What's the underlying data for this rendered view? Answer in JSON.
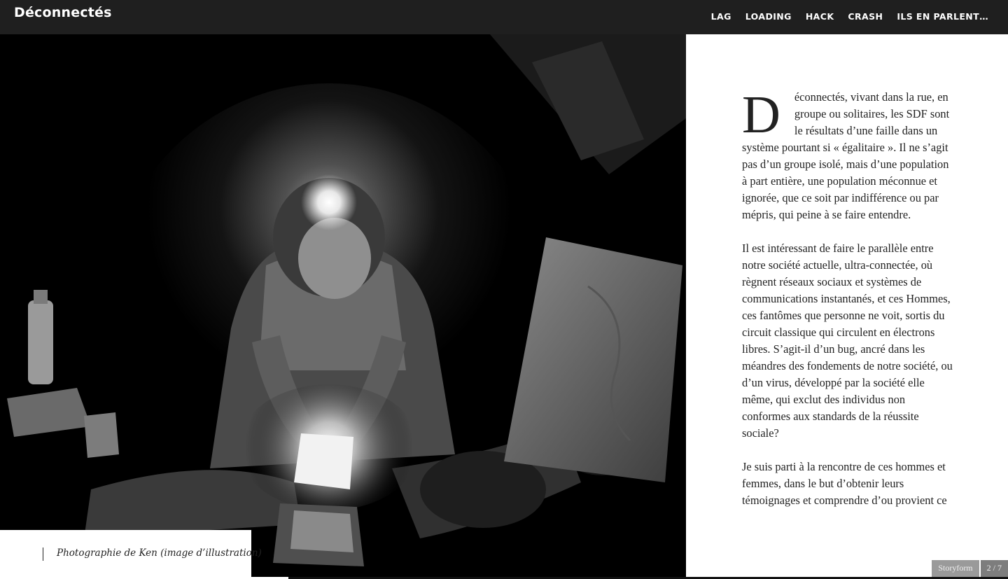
{
  "header": {
    "title": "Déconnectés",
    "nav": [
      "LAG",
      "LOADING",
      "HACK",
      "CRASH",
      "ILS EN PARLENT…"
    ]
  },
  "photo": {
    "caption": "Photographie de Ken (image d’illustration)"
  },
  "article": {
    "dropcap": "D",
    "paragraphs": [
      "éconnectés, vivant dans la rue, en groupe ou solitaires, les SDF sont le résultats d’une faille dans un système pourtant si « égalitaire ». Il ne s’agit pas d’un groupe isolé, mais d’une population à part entière, une population méconnue et ignorée, que ce soit par indifférence ou par mépris, qui peine à se faire entendre.",
      "Il est intéressant de faire le parallèle entre notre société actuelle, ultra-connectée, où règnent réseaux sociaux et systèmes de communications instantanés, et ces Hommes, ces fantômes que personne ne voit, sortis du circuit classique qui circulent en électrons libres. S’agit-il d’un bug, ancré dans les méandres des fondements de notre société, ou d’un virus, développé par la société elle même, qui exclut des individus non conformes aux standards de la réussite sociale?",
      "Je suis parti à la rencontre de ces hommes et femmes, dans le but d’obtenir leurs témoignages et comprendre d’ou provient ce"
    ]
  },
  "footer": {
    "brand": "Storyform",
    "pages": "2 / 7"
  }
}
